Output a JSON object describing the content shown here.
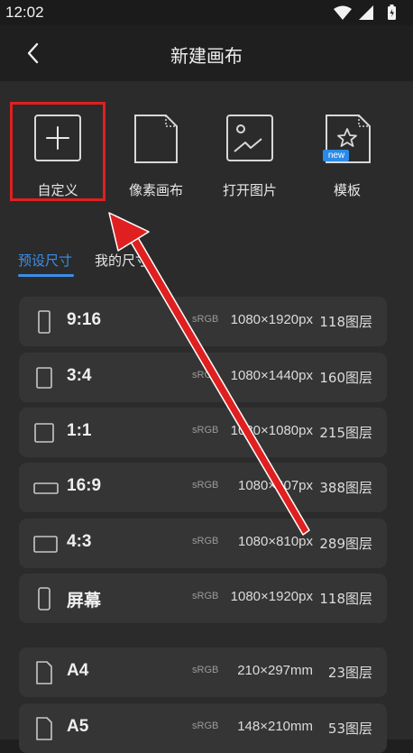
{
  "status": {
    "time": "12:02"
  },
  "header": {
    "title": "新建画布"
  },
  "tools": [
    {
      "label": "自定义",
      "icon": "plus-square-icon"
    },
    {
      "label": "像素画布",
      "icon": "blank-document-icon"
    },
    {
      "label": "打开图片",
      "icon": "image-icon"
    },
    {
      "label": "模板",
      "icon": "template-star-icon",
      "badge": "new"
    }
  ],
  "tabs": [
    {
      "label": "预设尺寸",
      "active": true
    },
    {
      "label": "我的尺寸",
      "active": false
    }
  ],
  "presets": [
    {
      "name": "9:16",
      "colorspace": "sRGB",
      "dims": "1080×1920px",
      "layers": "118图层",
      "shape": "portrait-tall-icon"
    },
    {
      "name": "3:4",
      "colorspace": "sRGB",
      "dims": "1080×1440px",
      "layers": "160图层",
      "shape": "portrait-icon"
    },
    {
      "name": "1:1",
      "colorspace": "sRGB",
      "dims": "1080×1080px",
      "layers": "215图层",
      "shape": "square-icon"
    },
    {
      "name": "16:9",
      "colorspace": "sRGB",
      "dims": "1080×607px",
      "layers": "388图层",
      "shape": "landscape-wide-icon"
    },
    {
      "name": "4:3",
      "colorspace": "sRGB",
      "dims": "1080×810px",
      "layers": "289图层",
      "shape": "landscape-icon"
    },
    {
      "name": "屏幕",
      "colorspace": "sRGB",
      "dims": "1080×1920px",
      "layers": "118图层",
      "shape": "phone-screen-icon"
    }
  ],
  "paper": [
    {
      "name": "A4",
      "colorspace": "sRGB",
      "dims": "210×297mm",
      "layers": "23图层",
      "shape": "paper-icon"
    },
    {
      "name": "A5",
      "colorspace": "sRGB",
      "dims": "148×210mm",
      "layers": "53图层",
      "shape": "paper-icon"
    }
  ],
  "colors": {
    "accent": "#3b8ee8",
    "highlight": "#e02020",
    "badge": "#2a8ae8"
  }
}
